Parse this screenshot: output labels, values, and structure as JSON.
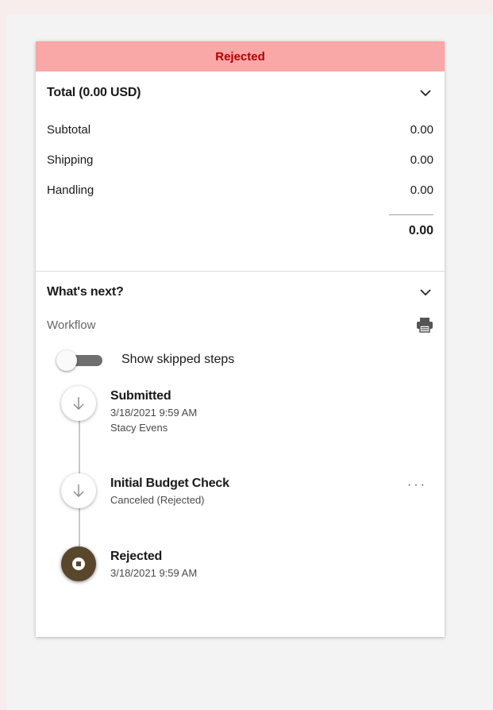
{
  "status": {
    "label": "Rejected",
    "bg": "#f9a7a7",
    "color": "#b00000"
  },
  "total": {
    "title": "Total (0.00 USD)",
    "expand_icon": "chevron-down-icon",
    "rows": [
      {
        "label": "Subtotal",
        "value": "0.00"
      },
      {
        "label": "Shipping",
        "value": "0.00"
      },
      {
        "label": "Handling",
        "value": "0.00"
      }
    ],
    "sum": "0.00"
  },
  "whats_next": {
    "title": "What's next?",
    "expand_icon": "chevron-down-icon",
    "workflow_label": "Workflow",
    "print_icon": "printer-icon",
    "toggle": {
      "label": "Show skipped steps",
      "on": false
    },
    "steps": [
      {
        "title": "Submitted",
        "line1": "3/18/2021 9:59 AM",
        "line2": "Stacy Evens",
        "icon": "arrow-down-icon"
      },
      {
        "title": "Initial Budget Check",
        "line1": "Canceled (Rejected)",
        "more": "···",
        "icon": "arrow-down-icon"
      },
      {
        "title": "Rejected",
        "line1": "3/18/2021 9:59 AM",
        "icon": "stop-icon",
        "color": "#5a472b"
      }
    ]
  }
}
